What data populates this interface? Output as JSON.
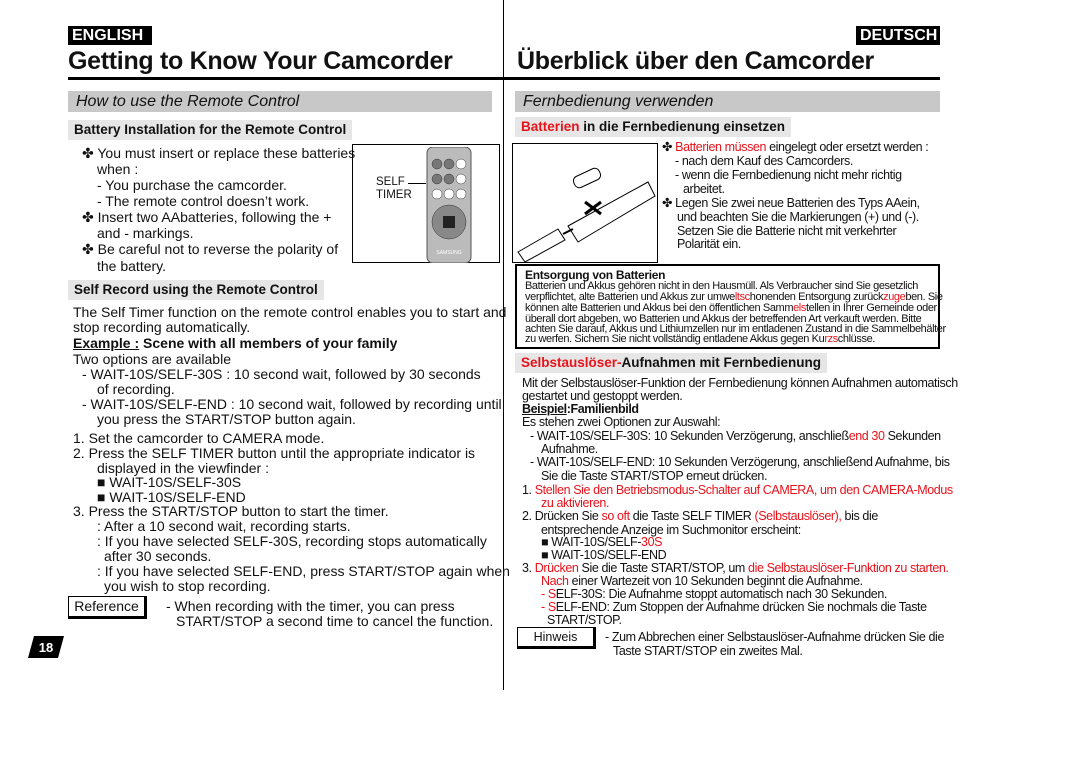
{
  "left": {
    "lang_badge": "ENGLISH",
    "title": "Getting to Know Your Camcorder",
    "section_bar": "How to use the Remote Control",
    "battery_heading": "Battery Installation for the Remote Control",
    "battery_lines": [
      "✤ You must insert or replace these batteries",
      "when :",
      "- You purchase the camcorder.",
      "- The remote control doesn’t work.",
      "✤ Insert two AAbatteries, following the +",
      "and - markings.",
      "✤ Be careful not to reverse the polarity of",
      "the battery."
    ],
    "remote_label": [
      "SELF",
      "TIMER"
    ],
    "remote_brand": "SAMSUNG",
    "self_heading": "Self Record using the Remote Control",
    "self_lines": [
      "The Self Timer function on the remote control enables you to start and",
      "stop recording automatically."
    ],
    "example_label": "Example :",
    "example_text": " Scene with all members of your family",
    "steps": [
      "Two options are available",
      "-  WAIT-10S/SELF-30S : 10 second wait, followed by 30 seconds",
      "of recording.",
      "-  WAIT-10S/SELF-END : 10 second wait, followed by recording until",
      "you press the START/STOP button again.",
      "1.  Set the camcorder to CAMERA mode.",
      "2.  Press the SELF TIMER button until the appropriate indicator is",
      "displayed in the viewfinder :",
      "■  WAIT-10S/SELF-30S",
      "■  WAIT-10S/SELF-END",
      "3.  Press the START/STOP button to start the timer.",
      ": After a 10 second wait, recording starts.",
      ": If you have selected SELF-30S, recording stops automatically",
      "after 30 seconds.",
      ": If you have selected SELF-END, press START/STOP again when",
      "you wish to stop recording."
    ],
    "reference_label": "Reference",
    "reference_text": [
      "- When recording with the timer, you can press",
      "START/STOP a second time to cancel the function."
    ],
    "page_number": "18"
  },
  "right": {
    "lang_badge": "DEUTSCH",
    "title": "Überblick über den Camcorder",
    "section_bar": "Fernbedienung verwenden",
    "battery_heading": [
      {
        "t": "Batterien",
        "red": true
      },
      {
        "t": " in die Fernbedienung einsetzen"
      }
    ],
    "battery_lines": [
      [
        {
          "t": "✤ "
        },
        {
          "t": "Batterien müssen",
          "red": true
        },
        {
          "t": " eingelegt oder ersetzt werden :"
        }
      ],
      [
        {
          "t": "- nach dem Kauf des Camcorders."
        }
      ],
      [
        {
          "t": "- wenn die Fernbedienung nicht mehr richtig"
        }
      ],
      [
        {
          "t": "arbeitet."
        }
      ],
      [
        {
          "t": "✤ Legen Sie zwei neue Batterien des Typs AAein,"
        }
      ],
      [
        {
          "t": "und beachten Sie die Markierungen (+) und (-)."
        }
      ],
      [
        {
          "t": "Setzen Sie die Batterie nicht mit verkehrter"
        }
      ],
      [
        {
          "t": "Polarität ein."
        }
      ]
    ],
    "disposal_heading": "Entsorgung von Batterien",
    "disposal_lines": [
      [
        {
          "t": "Batterien und Akkus gehören nicht in den Hausmüll. Als Verbraucher sind Sie gesetzlich"
        }
      ],
      [
        {
          "t": "verpflichtet, alte Batterien und Akkus zur umwe"
        },
        {
          "t": "ltsc",
          "red": true
        },
        {
          "t": "honenden Entsorgung zurück"
        },
        {
          "t": "zuge",
          "red": true
        },
        {
          "t": "ben. Sie"
        }
      ],
      [
        {
          "t": "können alte Batterien und Akkus bei den öffentlichen Samm"
        },
        {
          "t": "els",
          "red": true
        },
        {
          "t": "tellen in Ihrer Gemeinde oder"
        }
      ],
      [
        {
          "t": "überall dort abgeben, wo Batterien und Akkus der betreffenden Art verkauft werden. Bitte"
        }
      ],
      [
        {
          "t": "achten Sie darauf, Akkus und Lithiumzellen nur im entladenen Zustand in die Sammelbehälter"
        }
      ],
      [
        {
          "t": "zu werfen. Sichern Sie nicht vollständig entladene Akkus gegen Ku"
        },
        {
          "t": "rzs",
          "red": true
        },
        {
          "t": "chlüsse."
        }
      ]
    ],
    "self_heading": [
      {
        "t": "Selbstauslöser-",
        "red": true
      },
      {
        "t": "Aufnahmen mit Fernbedienung"
      }
    ],
    "self_lines": [
      [
        {
          "t": "Mit der Selbstauslöser-Funktion der Fernbedienung können Aufnahmen automatisch"
        }
      ],
      [
        {
          "t": "gestartet und gestoppt werden."
        }
      ]
    ],
    "example_label": "Beispiel",
    "example_text": ":Familienbild",
    "steps": [
      [
        {
          "t": "Es stehen zwei Optionen zur Auswahl:"
        }
      ],
      [
        {
          "t": "-  WAIT-10S/SELF-30S: 10 Sekunden Verzögerung, anschließ"
        },
        {
          "t": "end 30",
          "red": true
        },
        {
          "t": " Sekunden"
        }
      ],
      [
        {
          "t": "Aufnahme."
        }
      ],
      [
        {
          "t": "-  WAIT-10S/SELF-END: 10 Sekunden Verzögerung, anschließend Aufnahme, bis"
        }
      ],
      [
        {
          "t": "Sie die Taste START/STOP erneut drücken."
        }
      ],
      [
        {
          "t": "1.  "
        },
        {
          "t": "Stellen Sie den Betriebsmodus-Schalter auf CAMERA, um den CAMERA-Modus",
          "red": true
        }
      ],
      [
        {
          "t": "zu aktivieren.",
          "red": true
        }
      ],
      [
        {
          "t": "2.  Drücken Sie "
        },
        {
          "t": "so oft",
          "red": true
        },
        {
          "t": " die Taste SELF TIMER "
        },
        {
          "t": "(Selbstauslöser),",
          "red": true
        },
        {
          "t": " bis die"
        }
      ],
      [
        {
          "t": "entsprechende Anzeige im Suchmonitor erscheint:"
        }
      ],
      [
        {
          "t": "■  WAIT-10S/SELF-"
        },
        {
          "t": "30S",
          "red": true
        }
      ],
      [
        {
          "t": "■  WAIT-10S/SELF-END"
        }
      ],
      [
        {
          "t": "3.  "
        },
        {
          "t": "Drücken",
          "red": true
        },
        {
          "t": " Sie die Taste START/STOP, um "
        },
        {
          "t": "die Selbstauslöser-Funktion zu starten.",
          "red": true
        }
      ],
      [
        {
          "t": "Nach",
          "red": true
        },
        {
          "t": " einer Wartezeit von 10 Sekunden beginnt die Aufnahme."
        }
      ],
      [
        {
          "t": "- S",
          "red": true
        },
        {
          "t": "ELF-30S: Die Aufnahme stoppt automatisch nach 30 Sekunden."
        }
      ],
      [
        {
          "t": "- S",
          "red": true
        },
        {
          "t": "ELF-END: Zum Stoppen der Aufnahme drücken Sie nochmals die Taste"
        }
      ],
      [
        {
          "t": "START/STOP."
        }
      ]
    ],
    "hint_label": "Hinweis",
    "hint_text": [
      "- Zum Abbrechen einer Selbstauslöser-Aufnahme drücken Sie die",
      "Taste START/STOP ein zweites Mal."
    ]
  },
  "colors": {
    "accent_red": "#e8121a",
    "bar_grey": "#c8c8c8"
  }
}
